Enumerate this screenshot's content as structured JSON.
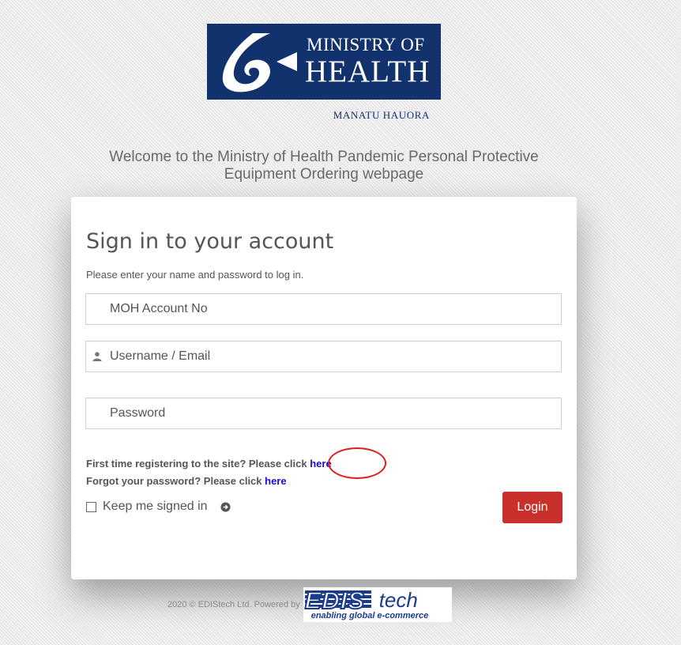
{
  "logo": {
    "line1": "MINISTRY OF",
    "line2": "HEALTH",
    "sub": "MANATU HAUORA",
    "brand_color": "#12326e"
  },
  "welcome": {
    "line1": "Welcome to the Ministry of Health Pandemic Personal Protective",
    "line2": "Equipment Ordering webpage"
  },
  "login": {
    "title": "Sign in to your account",
    "subtitle": "Please enter your name and password to log in.",
    "account_placeholder": "MOH Account No",
    "username_placeholder": "Username / Email",
    "password_placeholder": "Password",
    "register_prompt": "First time registering to the site? Please click ",
    "register_link": "here",
    "forgot_prompt": "Forgot your password? Please click ",
    "forgot_link": "here",
    "keep_signed_in": "Keep me signed in",
    "login_button": "Login",
    "button_color": "#c9302c",
    "link_color": "#1a0dcc",
    "annotation_color": "#e01b1b"
  },
  "footer": {
    "text": "2020 © EDIStech Ltd. Powered by",
    "logo_main": "EDIS",
    "logo_suffix": "tech",
    "logo_tagline": "enabling global e-commerce"
  }
}
